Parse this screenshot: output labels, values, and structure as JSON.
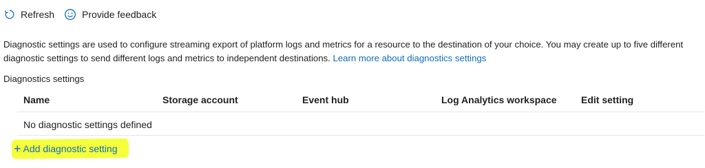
{
  "toolbar": {
    "refresh_label": "Refresh",
    "feedback_label": "Provide feedback"
  },
  "description": {
    "text": "Diagnostic settings are used to configure streaming export of platform logs and metrics for a resource to the destination of your choice. You may create up to five different diagnostic settings to send different logs and metrics to independent destinations.",
    "link_text": "Learn more about diagnostics settings"
  },
  "section": {
    "title": "Diagnostics settings"
  },
  "table": {
    "columns": [
      "Name",
      "Storage account",
      "Event hub",
      "Log Analytics workspace",
      "Edit setting"
    ],
    "empty_message": "No diagnostic settings defined"
  },
  "actions": {
    "add_label": "Add diagnostic setting",
    "add_icon": "+"
  },
  "colors": {
    "link": "#0f6cbd",
    "highlight": "#f5ff3b"
  }
}
